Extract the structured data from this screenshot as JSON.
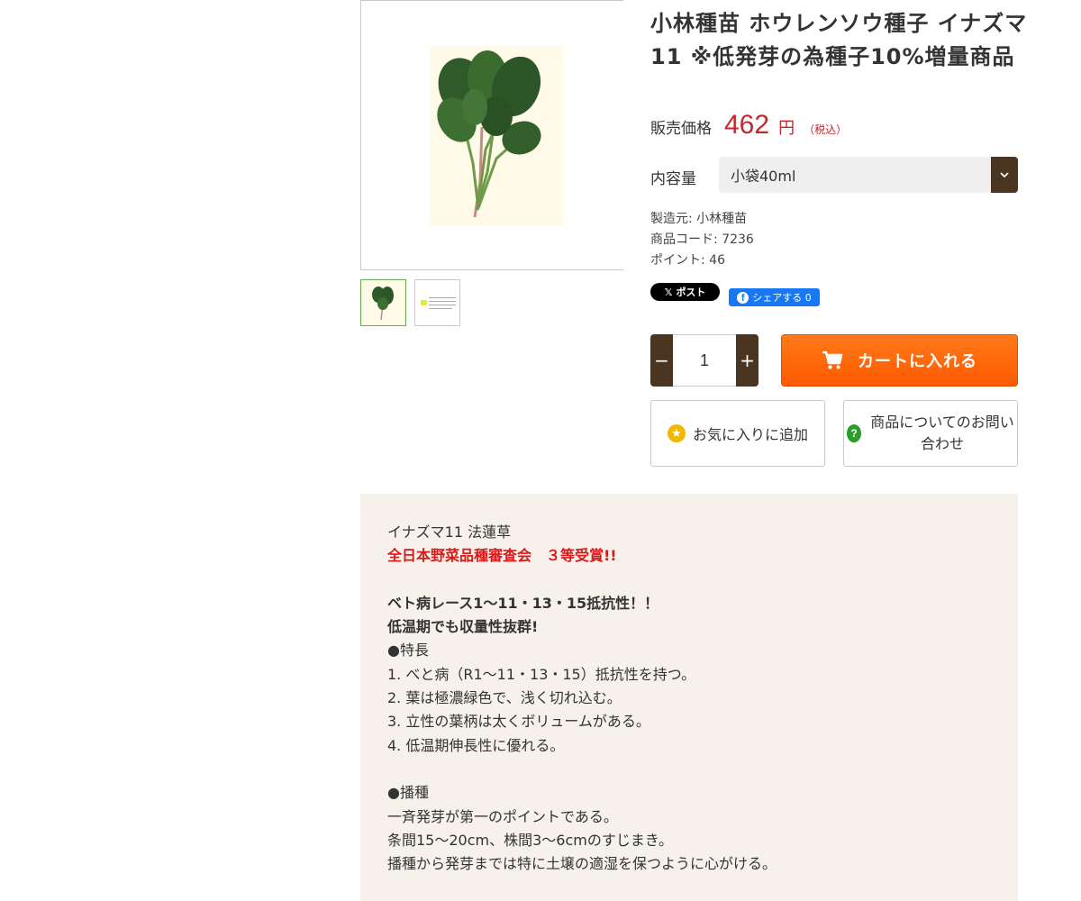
{
  "product": {
    "title": "小林種苗 ホウレンソウ種子 イナズマ11 ※低発芽の為種子10%増量商品",
    "price_label": "販売価格",
    "price": "462",
    "price_unit": "円",
    "price_tax": "（税込）",
    "volume_label": "内容量",
    "volume_selected": "小袋40ml",
    "maker": "製造元: 小林種苗",
    "code": "商品コード: 7236",
    "points": "ポイント: 46"
  },
  "share": {
    "x_label": "ポスト",
    "fb_label": "シェアする 0"
  },
  "cart": {
    "quantity": "1",
    "minus": "−",
    "plus": "+",
    "add_label": "カートに入れる"
  },
  "actions": {
    "favorite_label": "お気に入りに追加",
    "inquiry_label": "商品についてのお問い合わせ"
  },
  "description": {
    "lines": [
      {
        "text": "イナズマ11 法蓮草",
        "style": ""
      },
      {
        "text": "全日本野菜品種審査会　３等受賞!!",
        "style": "red"
      },
      {
        "text": "",
        "style": ""
      },
      {
        "text": "ベト病レース1〜11・13・15抵抗性！！",
        "style": "bold"
      },
      {
        "text": "低温期でも収量性抜群!",
        "style": "bold"
      },
      {
        "text": "●特長",
        "style": ""
      },
      {
        "text": "1.  べと病（R1〜11・13・15）抵抗性を持つ。",
        "style": ""
      },
      {
        "text": "2.  葉は極濃緑色で、浅く切れ込む。",
        "style": ""
      },
      {
        "text": "3.  立性の葉柄は太くボリュームがある。",
        "style": ""
      },
      {
        "text": "4.  低温期伸長性に優れる。",
        "style": ""
      },
      {
        "text": "",
        "style": ""
      },
      {
        "text": "●播種",
        "style": ""
      },
      {
        "text": "一斉発芽が第一のポイントである。",
        "style": ""
      },
      {
        "text": "条間15〜20cm、株間3〜6cmのすじまき。",
        "style": ""
      },
      {
        "text": "播種から発芽までは特に土壌の適湿を保つように心がける。",
        "style": ""
      }
    ]
  },
  "colors": {
    "price_red": "#c1272d",
    "brown": "#4a3520",
    "cart_orange": "#ff6a00",
    "desc_bg": "#f6f1ea"
  },
  "icons": [
    "spinach-photo",
    "chevron-down-icon",
    "x-logo-icon",
    "facebook-icon",
    "cart-icon",
    "star-icon",
    "question-icon"
  ]
}
